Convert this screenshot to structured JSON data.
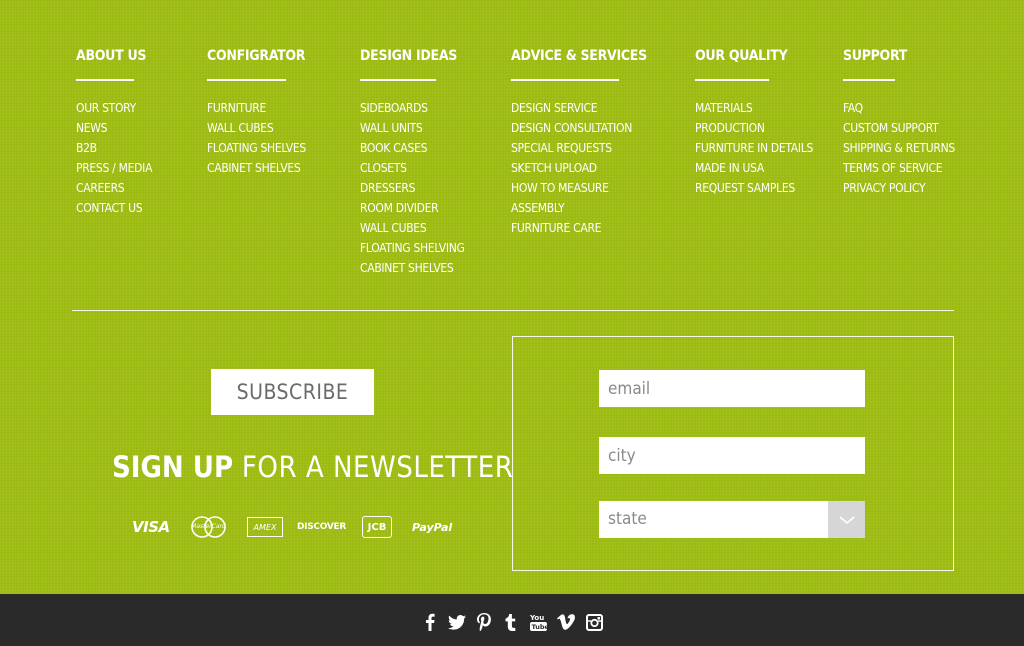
{
  "columns": [
    {
      "title": "ABOUT US",
      "items": [
        "OUR STORY",
        "NEWS",
        "B2B",
        "PRESS / MEDIA",
        "CAREERS",
        "CONTACT US"
      ]
    },
    {
      "title": "CONFIGRATOR",
      "items": [
        "FURNITURE",
        "WALL CUBES",
        "FLOATING SHELVES",
        "CABINET SHELVES"
      ]
    },
    {
      "title": "DESIGN IDEAS",
      "items": [
        "SIDEBOARDS",
        "WALL UNITS",
        "BOOK CASES",
        "CLOSETS",
        "DRESSERS",
        "ROOM DIVIDER",
        "WALL CUBES",
        "FLOATING SHELVING",
        "CABINET SHELVES"
      ]
    },
    {
      "title": "ADVICE & SERVICES",
      "items": [
        "DESIGN SERVICE",
        "DESIGN CONSULTATION",
        "SPECIAL REQUESTS",
        "SKETCH UPLOAD",
        "HOW TO MEASURE",
        "ASSEMBLY",
        "FURNITURE CARE"
      ]
    },
    {
      "title": "OUR QUALITY",
      "items": [
        "MATERIALS",
        "PRODUCTION",
        "FURNITURE IN DETAILS",
        "MADE IN USA",
        "REQUEST SAMPLES"
      ]
    },
    {
      "title": "SUPPORT",
      "items": [
        "FAQ",
        "CUSTOM SUPPORT",
        "SHIPPING & RETURNS",
        "TERMS OF SERVICE",
        "PRIVACY POLICY"
      ]
    }
  ],
  "newsletter": {
    "subscribe_label": "SUBSCRIBE",
    "signup_bold": "SIGN UP",
    "signup_rest": " FOR A NEWSLETTER",
    "payments": [
      "VISA",
      "MasterCard",
      "AMEX",
      "DISCOVER",
      "JCB",
      "PayPal"
    ]
  },
  "form": {
    "email_placeholder": "email",
    "city_placeholder": "city",
    "state_value": "state"
  },
  "social": [
    "facebook-icon",
    "twitter-icon",
    "pinterest-icon",
    "tumblr-icon",
    "youtube-icon",
    "vimeo-icon",
    "instagram-icon"
  ],
  "colors": {
    "background": "#9bbb0f",
    "footer_bar": "#2a2a2a",
    "text": "#ffffff"
  }
}
